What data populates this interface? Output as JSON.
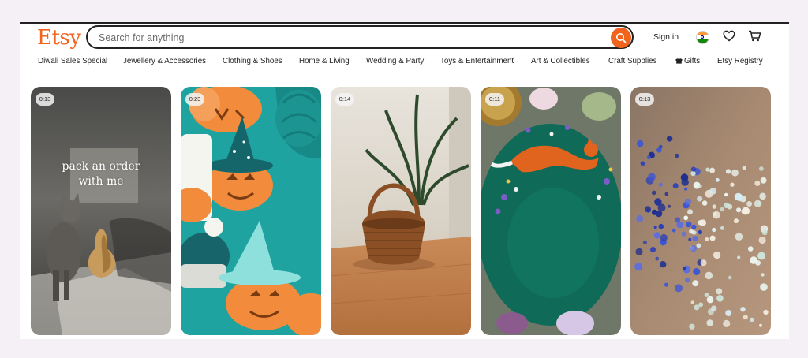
{
  "header": {
    "logo": "Etsy",
    "search": {
      "placeholder": "Search for anything",
      "value": ""
    },
    "sign_in": "Sign in",
    "icons": [
      "search-icon",
      "india-flag-icon",
      "heart-icon",
      "cart-icon"
    ]
  },
  "nav": {
    "items": [
      {
        "label": "Diwali Sales Special"
      },
      {
        "label": "Jewellery & Accessories"
      },
      {
        "label": "Clothing & Shoes"
      },
      {
        "label": "Home & Living"
      },
      {
        "label": "Wedding & Party"
      },
      {
        "label": "Toys & Entertainment"
      },
      {
        "label": "Art & Collectibles"
      },
      {
        "label": "Craft Supplies"
      },
      {
        "label": "Gifts",
        "icon": "gift-icon"
      },
      {
        "label": "Etsy Registry"
      }
    ]
  },
  "videos": [
    {
      "duration": "0:13",
      "overlay_line1": "pack an order",
      "overlay_line2": "with me"
    },
    {
      "duration": "0:23"
    },
    {
      "duration": "0:14"
    },
    {
      "duration": "0:11"
    },
    {
      "duration": "0:13"
    }
  ],
  "colors": {
    "brand": "#f1641e",
    "background": "#f5f0f5"
  }
}
